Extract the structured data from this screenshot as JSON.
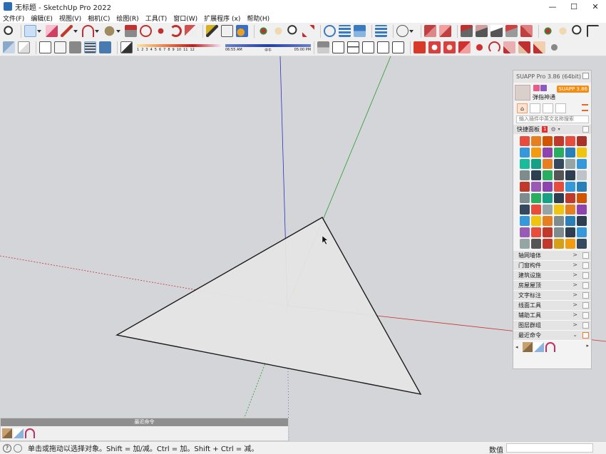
{
  "window": {
    "title": "无标题 - SketchUp Pro 2022",
    "minimize": "—",
    "maximize": "☐",
    "close": "✕"
  },
  "menu": [
    "文件(F)",
    "编辑(E)",
    "视图(V)",
    "相机(C)",
    "绘图(R)",
    "工具(T)",
    "窗口(W)",
    "扩展程序 (x)",
    "帮助(H)"
  ],
  "shadow": {
    "ticks": [
      "1",
      "2",
      "3",
      "4",
      "5",
      "6",
      "7",
      "8",
      "9",
      "10",
      "11",
      "12"
    ],
    "time_start": "06:55 AM",
    "time_mid": "中午",
    "time_end": "05:00 PM"
  },
  "suapp": {
    "title": "SUAPP Pro 3.86 (64bit)",
    "username": "弹指神通",
    "version_badge": "SUAPP 3.86",
    "search_placeholder": "输入插件中英文名称搜索",
    "favorites_label": "快捷面板",
    "favorites_badge": "1",
    "gear": "⚙",
    "dropdown": "▾",
    "home": "⌂",
    "categories": [
      {
        "label": "轴网墙体"
      },
      {
        "label": "门窗构件"
      },
      {
        "label": "建筑设施"
      },
      {
        "label": "房屋屋顶"
      },
      {
        "label": "文字标注"
      },
      {
        "label": "线面工具"
      },
      {
        "label": "辅助工具"
      },
      {
        "label": "图层群组"
      },
      {
        "label": "最近命令"
      }
    ],
    "arrow_right": ">",
    "arrow_down": "⌄",
    "scroll_left": "◂",
    "scroll_right": "▸"
  },
  "recent_panel": {
    "title": "最近命令"
  },
  "status": {
    "hint": "单击或拖动以选择对象。Shift = 加/减。Ctrl = 加。Shift + Ctrl = 减。",
    "measure_label": "数值",
    "info_icon": "?"
  },
  "colors": {
    "viewport": "#d4d5d9",
    "axis_red": "#c83232",
    "axis_green": "#2a9a2a",
    "axis_blue": "#2d2dbf",
    "face": "#e5e5e5",
    "accent": "#f28c13"
  }
}
